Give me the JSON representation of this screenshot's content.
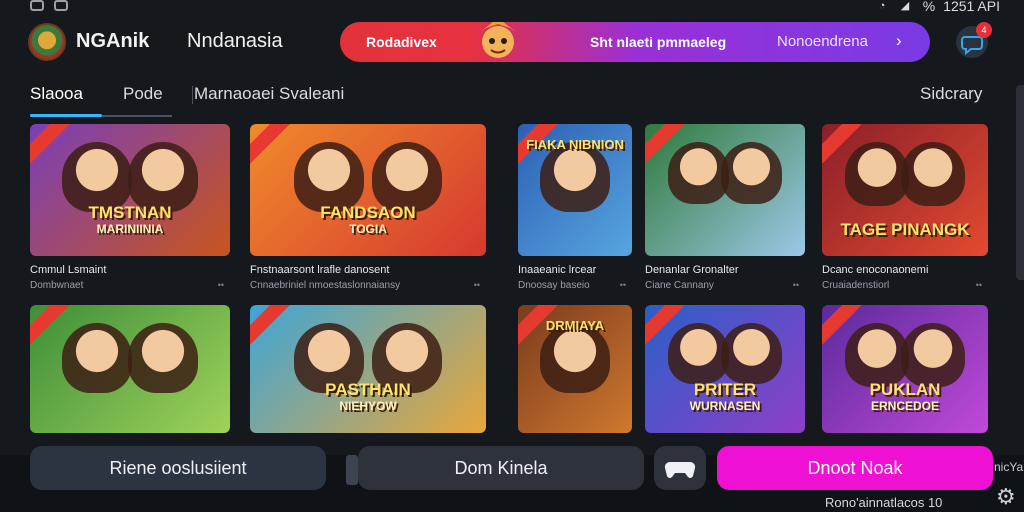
{
  "status": {
    "time": "1251 API",
    "battery": "%"
  },
  "header": {
    "brand": "NGAnik",
    "region": "Nndanasia",
    "promo_left": "Rodadivex",
    "promo_mid": "Sht nlaeti pmmaeleg",
    "promo_right": "Nonoendrena",
    "promo_arrow": "›",
    "notification_badge": "4"
  },
  "tabs": [
    "Slaooa",
    "Pode",
    "Marnaoaei Svaleani",
    "Sidcrary"
  ],
  "games_row1": [
    {
      "art": "TMSTNAN",
      "art_sub": "MARINIINIA",
      "title": "Cmmul Lsmaint",
      "sub": "Dombwnaet",
      "colors": [
        "#7a3fb8",
        "#c8551c"
      ]
    },
    {
      "art": "FANDSAON",
      "art_sub": "TOGIA",
      "title": "Fnstnaarsont lrafle danosent",
      "sub": "Cnnaebriniel nmoestaslonnaiansy",
      "colors": [
        "#f08a2c",
        "#d6392f"
      ]
    },
    {
      "art": "FIAKA NIBNION",
      "art_sub": "",
      "title": "Inaaeanic lrcear",
      "sub": "Dnoosay baseio",
      "colors": [
        "#2c5fb4",
        "#57a6e0"
      ]
    },
    {
      "art": "",
      "art_sub": "",
      "title": "Denanlar Gronalter",
      "sub": "Ciane Cannany",
      "colors": [
        "#2f7a3a",
        "#9dc8e8"
      ]
    },
    {
      "art": "TAGE PINANGK",
      "art_sub": "",
      "title": "Dcanc enoconaonemi",
      "sub": "Cruaiadenstiorl",
      "colors": [
        "#8a1f2a",
        "#e34a2f"
      ]
    }
  ],
  "games_row2": [
    {
      "art": "",
      "colors": [
        "#3e8e3a",
        "#9fd35a"
      ]
    },
    {
      "art": "PASTHAIN",
      "art_sub": "NIEHYOW",
      "colors": [
        "#3da5d8",
        "#e9a73a"
      ]
    },
    {
      "art": "DRMIAYA",
      "art_sub": "",
      "colors": [
        "#7a3b1e",
        "#d0782e"
      ]
    },
    {
      "art": "PRITER",
      "art_sub": "WURNASEN",
      "colors": [
        "#2b5fc8",
        "#8f3ec8"
      ]
    },
    {
      "art": "PUKLAN",
      "art_sub": "ERNCEDOE",
      "colors": [
        "#5a2a9c",
        "#c04ad8"
      ]
    }
  ],
  "bottom": {
    "btn_secondary": "Riene ooslusiient",
    "btn_middle": "Dom Kinela",
    "btn_primary": "Dnoot Noak",
    "note": "Rono'ainnatlacos 10",
    "edge_text": "nicYa"
  }
}
